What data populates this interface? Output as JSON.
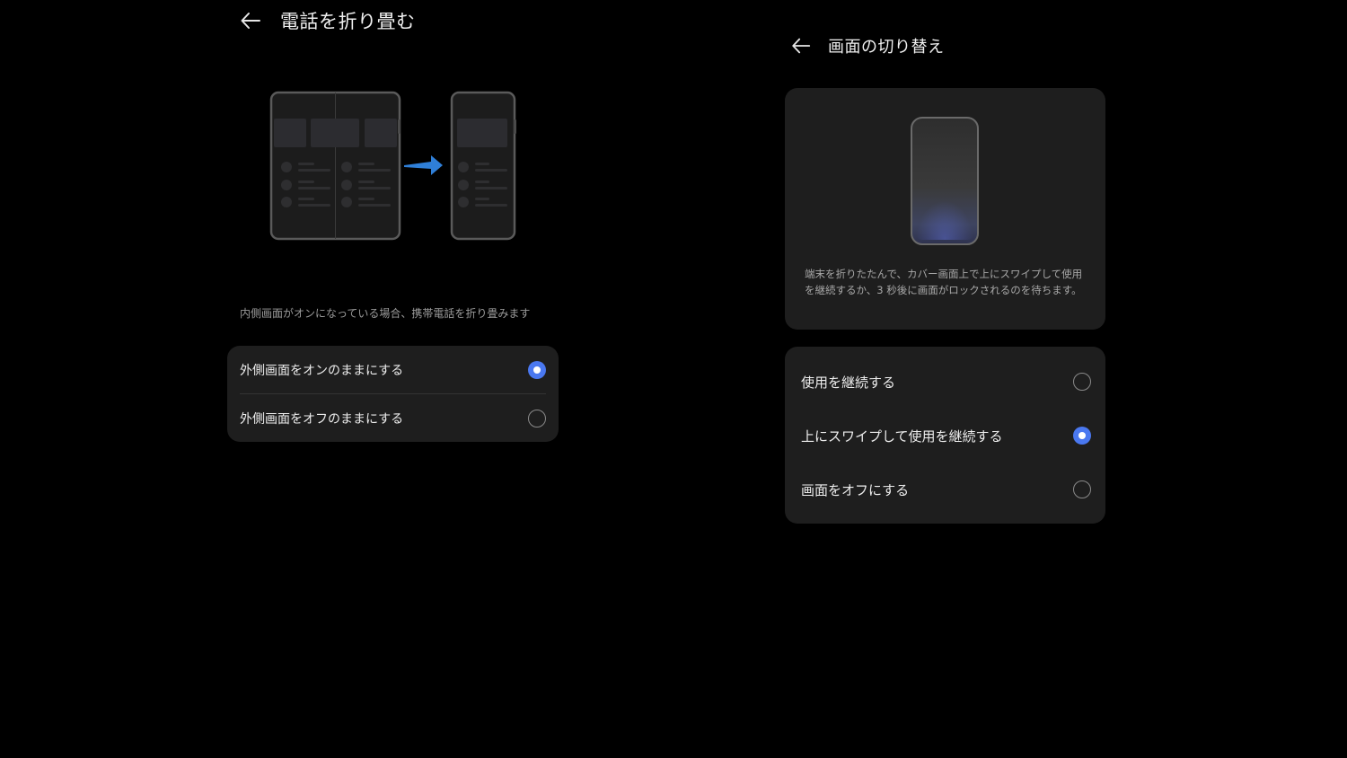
{
  "left_panel": {
    "title": "電話を折り畳む",
    "description": "内側画面がオンになっている場合、携帯電話を折り畳みます",
    "options": [
      {
        "label": "外側画面をオンのままにする",
        "selected": true
      },
      {
        "label": "外側画面をオフのままにする",
        "selected": false
      }
    ]
  },
  "right_panel": {
    "title": "画面の切り替え",
    "description": "端末を折りたたんで、カバー画面上で上にスワイプして使用を継続するか、3 秒後に画面がロックされるのを待ちます。",
    "options": [
      {
        "label": "使用を継続する",
        "selected": false
      },
      {
        "label": "上にスワイプして使用を継続する",
        "selected": true
      },
      {
        "label": "画面をオフにする",
        "selected": false
      }
    ]
  },
  "colors": {
    "background": "#000000",
    "card": "#1e1e1e",
    "accent": "#4a78f0",
    "arrow_blue": "#2f7fd8"
  },
  "icons": {
    "back": "back-arrow-icon",
    "fold": "fold-phone-illustration",
    "preview": "cover-screen-phone-preview"
  }
}
